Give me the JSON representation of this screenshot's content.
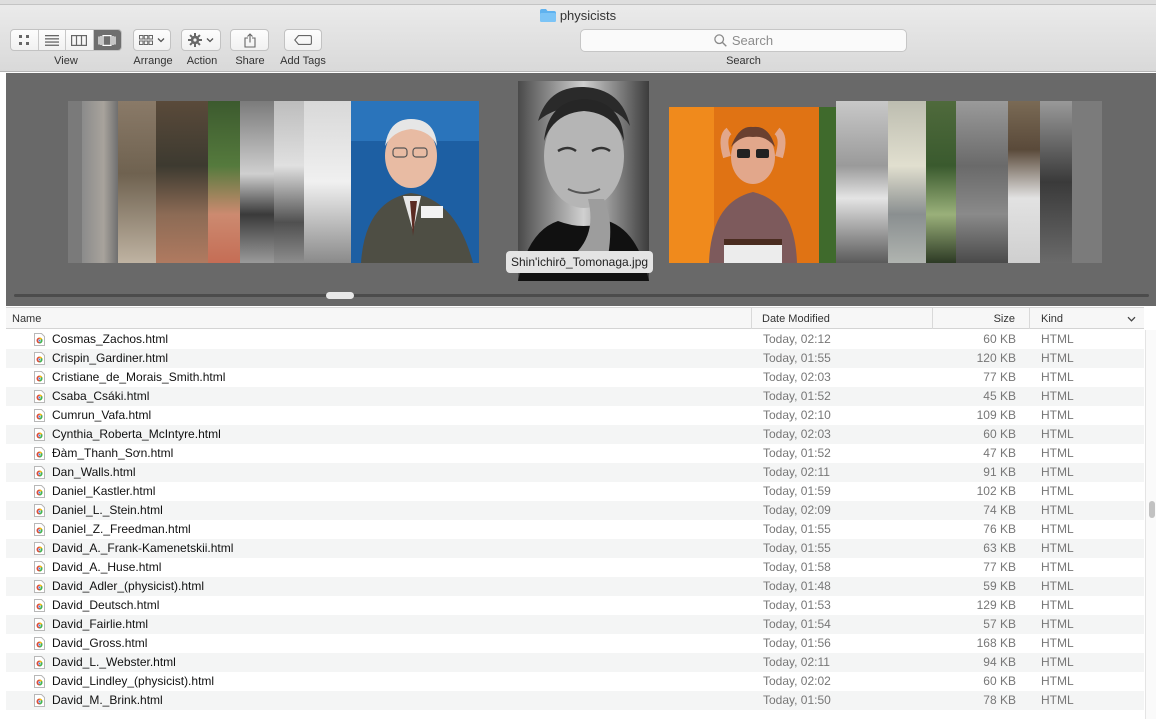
{
  "window": {
    "title": "physicists"
  },
  "toolbar": {
    "view_label": "View",
    "arrange_label": "Arrange",
    "action_label": "Action",
    "share_label": "Share",
    "add_tags_label": "Add Tags",
    "search_label": "Search",
    "search_placeholder": "Search",
    "active_view": "cover-flow"
  },
  "coverflow": {
    "selected_caption": "Shin'ichirō_Tomonaga.jpg"
  },
  "columns": {
    "name": "Name",
    "date_modified": "Date Modified",
    "size": "Size",
    "kind": "Kind"
  },
  "files": [
    {
      "name": "Cosmas_Zachos.html",
      "date": "Today, 02:12",
      "size": "60 KB",
      "kind": "HTML"
    },
    {
      "name": "Crispin_Gardiner.html",
      "date": "Today, 01:55",
      "size": "120 KB",
      "kind": "HTML"
    },
    {
      "name": "Cristiane_de_Morais_Smith.html",
      "date": "Today, 02:03",
      "size": "77 KB",
      "kind": "HTML"
    },
    {
      "name": "Csaba_Csáki.html",
      "date": "Today, 01:52",
      "size": "45 KB",
      "kind": "HTML"
    },
    {
      "name": "Cumrun_Vafa.html",
      "date": "Today, 02:10",
      "size": "109 KB",
      "kind": "HTML"
    },
    {
      "name": "Cynthia_Roberta_McIntyre.html",
      "date": "Today, 02:03",
      "size": "60 KB",
      "kind": "HTML"
    },
    {
      "name": "Đàm_Thanh_Sơn.html",
      "date": "Today, 01:52",
      "size": "47 KB",
      "kind": "HTML"
    },
    {
      "name": "Dan_Walls.html",
      "date": "Today, 02:11",
      "size": "91 KB",
      "kind": "HTML"
    },
    {
      "name": "Daniel_Kastler.html",
      "date": "Today, 01:59",
      "size": "102 KB",
      "kind": "HTML"
    },
    {
      "name": "Daniel_L._Stein.html",
      "date": "Today, 02:09",
      "size": "74 KB",
      "kind": "HTML"
    },
    {
      "name": "Daniel_Z._Freedman.html",
      "date": "Today, 01:55",
      "size": "76 KB",
      "kind": "HTML"
    },
    {
      "name": "David_A._Frank-Kamenetskii.html",
      "date": "Today, 01:55",
      "size": "63 KB",
      "kind": "HTML"
    },
    {
      "name": "David_A._Huse.html",
      "date": "Today, 01:58",
      "size": "77 KB",
      "kind": "HTML"
    },
    {
      "name": "David_Adler_(physicist).html",
      "date": "Today, 01:48",
      "size": "59 KB",
      "kind": "HTML"
    },
    {
      "name": "David_Deutsch.html",
      "date": "Today, 01:53",
      "size": "129 KB",
      "kind": "HTML"
    },
    {
      "name": "David_Fairlie.html",
      "date": "Today, 01:54",
      "size": "57 KB",
      "kind": "HTML"
    },
    {
      "name": "David_Gross.html",
      "date": "Today, 01:56",
      "size": "168 KB",
      "kind": "HTML"
    },
    {
      "name": "David_L._Webster.html",
      "date": "Today, 02:11",
      "size": "94 KB",
      "kind": "HTML"
    },
    {
      "name": "David_Lindley_(physicist).html",
      "date": "Today, 02:02",
      "size": "60 KB",
      "kind": "HTML"
    },
    {
      "name": "David_M._Brink.html",
      "date": "Today, 01:50",
      "size": "78 KB",
      "kind": "HTML"
    }
  ]
}
